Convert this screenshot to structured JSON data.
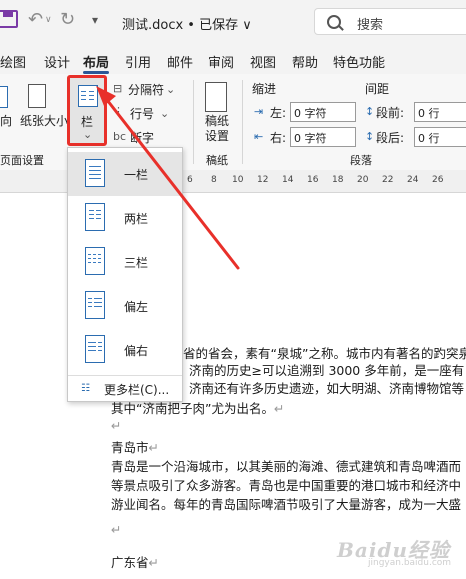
{
  "titlebar": {
    "doc_title": "测试.docx • 已保存 ∨",
    "search_placeholder": "搜索",
    "undo_glyph": "↶",
    "redo_glyph": "↻",
    "caret_glyph": "∨",
    "more_glyph": "▾"
  },
  "tabs": [
    "绘图",
    "设计",
    "布局",
    "引用",
    "邮件",
    "审阅",
    "视图",
    "帮助",
    "特色功能"
  ],
  "active_tab": "布局",
  "ribbon": {
    "direction_label": "向",
    "paper_size_label": "纸张大小",
    "page_setup_group": "页面设置",
    "columns_label": "栏",
    "breaks_label": "分隔符",
    "line_numbers_label": "行号",
    "hyphenation_label": "断字",
    "manuscript_label": "稿纸\n设置",
    "manuscript_group": "稿纸",
    "indent_header": "缩进",
    "spacing_header": "间距",
    "indent_left_label": "左:",
    "indent_left_value": "0 字符",
    "indent_right_label": "右:",
    "indent_right_value": "0 字符",
    "space_before_label": "段前:",
    "space_before_value": "0 行",
    "space_after_label": "段后:",
    "space_after_value": "0 行",
    "paragraph_group": "段落"
  },
  "ruler_numbers": [
    "6",
    "8",
    "10",
    "12",
    "14",
    "16",
    "18",
    "20",
    "22",
    "24",
    "26"
  ],
  "columns_menu": {
    "items": [
      "一栏",
      "两栏",
      "三栏",
      "偏左",
      "偏右"
    ],
    "selected": "一栏",
    "more": "更多栏(C)..."
  },
  "document": {
    "lines": [
      "省的省会，素有“泉城”之称。城市内有著名的趵突泉",
      "济南的历史≥可以追溯到 3000 多年前，是一座有",
      "济南还有许多历史遗迹，如大明湖、济南博物馆等",
      "其中“济南把子肉”尤为出名。",
      "",
      "青岛市",
      "青岛是一个沿海城市，以其美丽的海滩、德式建筑和青岛啤酒而",
      "等景点吸引了众多游客。青岛也是中国重要的港口城市和经济中",
      "游业闻名。每年的青岛国际啤酒节吸引了大量游客，成为一大盛",
      "",
      "广东省"
    ],
    "para_mark": "↵"
  },
  "watermark": {
    "text": "Baidu经验",
    "sub": "jingyan.baidu.com"
  }
}
